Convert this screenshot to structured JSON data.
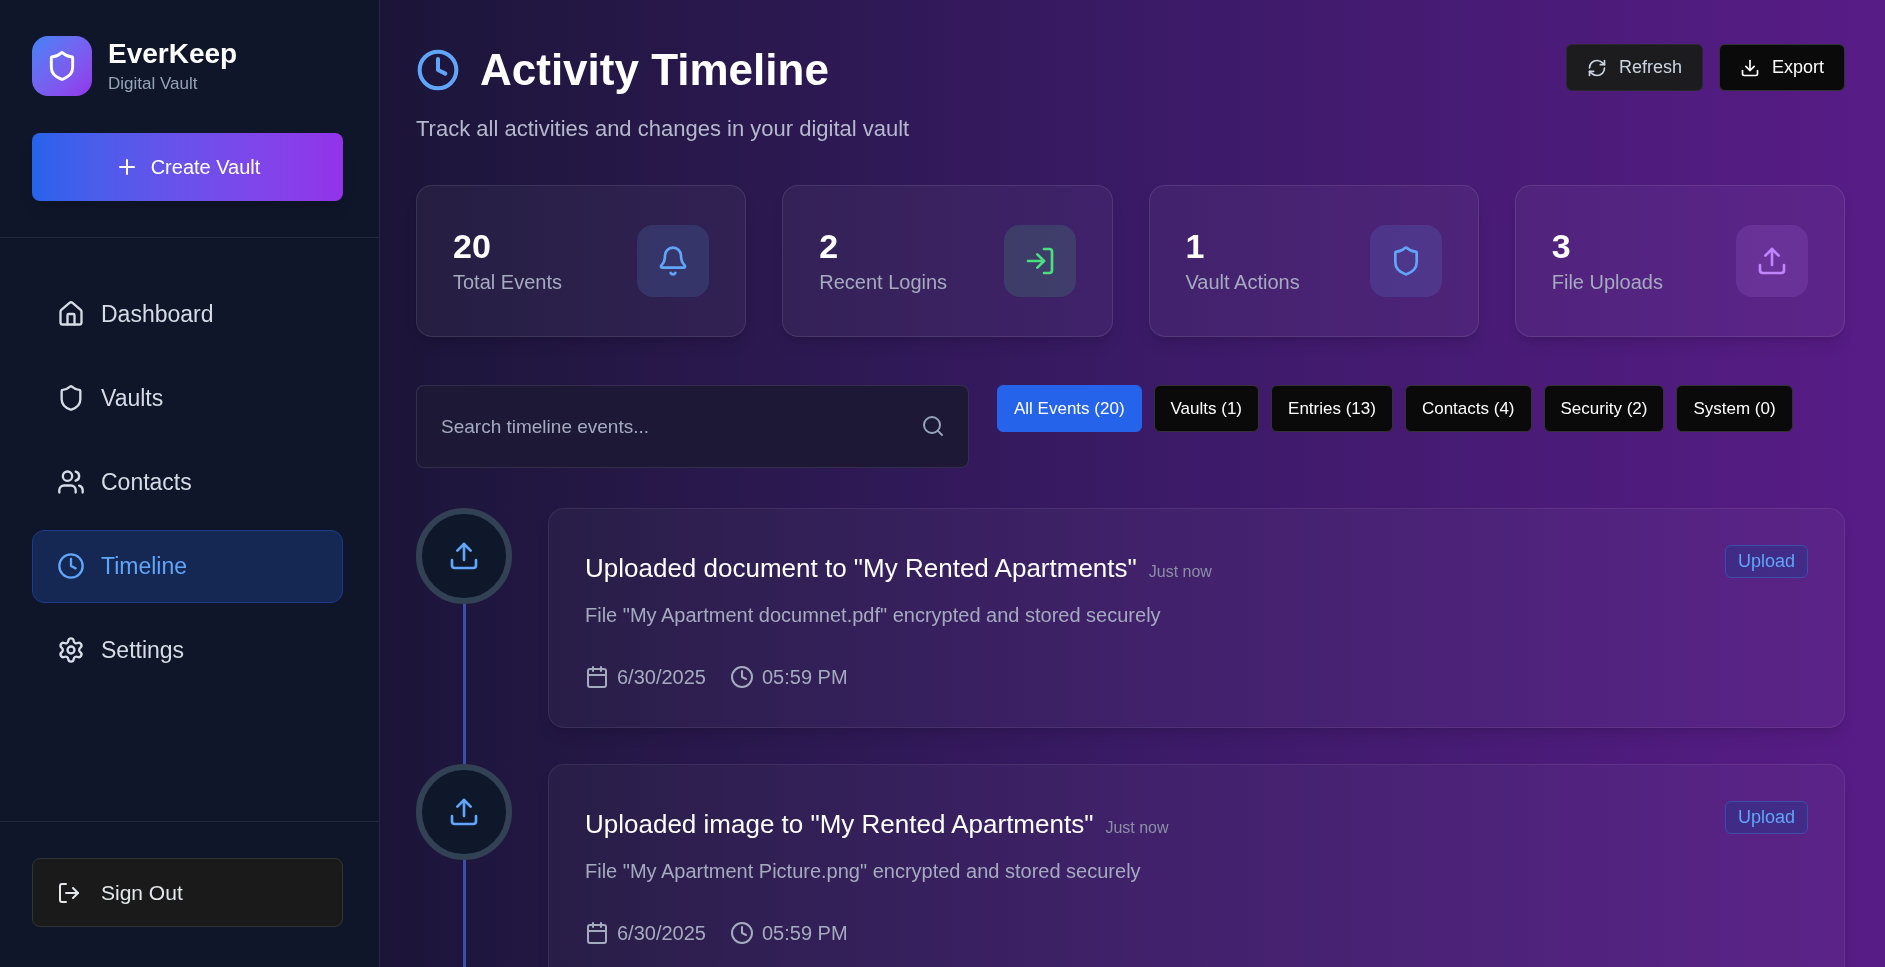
{
  "brand": {
    "name": "EverKeep",
    "tagline": "Digital Vault"
  },
  "create_button": "Create Vault",
  "nav": [
    {
      "kind": "home",
      "label": "Dashboard",
      "selected": false
    },
    {
      "kind": "shield",
      "label": "Vaults",
      "selected": false
    },
    {
      "kind": "users",
      "label": "Contacts",
      "selected": false
    },
    {
      "kind": "clock",
      "label": "Timeline",
      "selected": true
    },
    {
      "kind": "gear",
      "label": "Settings",
      "selected": false
    }
  ],
  "sign_out": "Sign Out",
  "header": {
    "title": "Activity Timeline",
    "subtitle": "Track all activities and changes in your digital vault",
    "actions": [
      {
        "kind": "refresh",
        "label": "Refresh"
      },
      {
        "kind": "export",
        "label": "Export"
      }
    ]
  },
  "stats": [
    {
      "kind": "bell",
      "value": "20",
      "label": "Total Events",
      "color": "#60a5fa"
    },
    {
      "kind": "login",
      "value": "2",
      "label": "Recent Logins",
      "color": "#4ade80"
    },
    {
      "kind": "shield",
      "value": "1",
      "label": "Vault Actions",
      "color": "#60a5fa"
    },
    {
      "kind": "upload",
      "value": "3",
      "label": "File Uploads",
      "color": "#c084fc"
    }
  ],
  "search": {
    "placeholder": "Search timeline events..."
  },
  "filters": [
    {
      "label": "All Events (20)",
      "selected": true
    },
    {
      "label": "Vaults (1)",
      "selected": false
    },
    {
      "label": "Entries (13)",
      "selected": false
    },
    {
      "label": "Contacts (4)",
      "selected": false
    },
    {
      "label": "Security (2)",
      "selected": false
    },
    {
      "label": "System (0)",
      "selected": false
    }
  ],
  "events": [
    {
      "kind": "upload",
      "title": "Uploaded document to \"My Rented Apartments\"",
      "time_ago": "Just now",
      "description": "File \"My Apartment documnet.pdf\" encrypted and stored securely",
      "date": "6/30/2025",
      "time": "05:59 PM",
      "badge": "Upload"
    },
    {
      "kind": "upload",
      "title": "Uploaded image to \"My Rented Apartments\"",
      "time_ago": "Just now",
      "description": "File \"My Apartment Picture.png\" encrypted and stored securely",
      "date": "6/30/2025",
      "time": "05:59 PM",
      "badge": "Upload"
    }
  ]
}
